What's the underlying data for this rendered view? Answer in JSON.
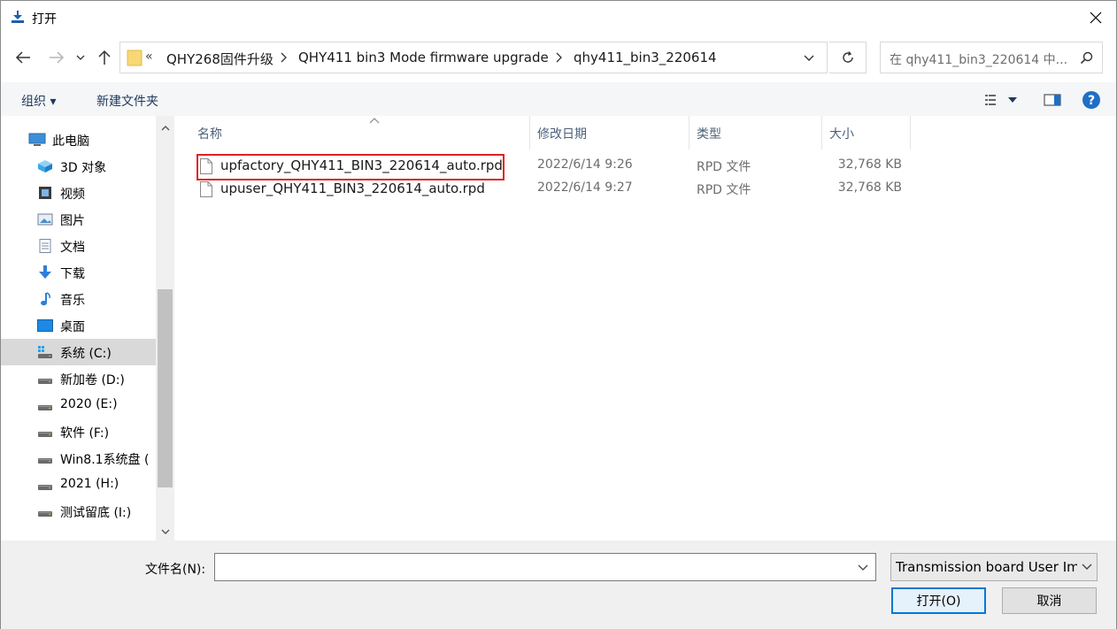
{
  "window": {
    "title": "打开"
  },
  "address": {
    "overflow": "«",
    "crumbs": [
      "QHY268固件升级",
      "QHY411 bin3 Mode firmware upgrade",
      "qhy411_bin3_220614"
    ]
  },
  "search": {
    "placeholder": "在 qhy411_bin3_220614 中..."
  },
  "toolbar": {
    "organize": "组织 ▾",
    "new_folder": "新建文件夹"
  },
  "nav": {
    "items": [
      {
        "label": "此电脑",
        "icon": "computer-icon"
      },
      {
        "label": "3D 对象",
        "icon": "cube-icon"
      },
      {
        "label": "视频",
        "icon": "video-icon"
      },
      {
        "label": "图片",
        "icon": "picture-icon"
      },
      {
        "label": "文档",
        "icon": "document-icon"
      },
      {
        "label": "下载",
        "icon": "download-icon"
      },
      {
        "label": "音乐",
        "icon": "music-icon"
      },
      {
        "label": "桌面",
        "icon": "desktop-icon"
      },
      {
        "label": "系统 (C:)",
        "icon": "system-drive-icon"
      },
      {
        "label": "新加卷 (D:)",
        "icon": "drive-icon"
      },
      {
        "label": "2020 (E:)",
        "icon": "drive-icon"
      },
      {
        "label": "软件 (F:)",
        "icon": "drive-icon"
      },
      {
        "label": "Win8.1系统盘 (",
        "icon": "drive-icon"
      },
      {
        "label": "2021 (H:)",
        "icon": "drive-icon"
      },
      {
        "label": "测试留底 (I:)",
        "icon": "drive-icon"
      }
    ]
  },
  "columns": {
    "name": "名称",
    "date": "修改日期",
    "type": "类型",
    "size": "大小"
  },
  "files": [
    {
      "name": "upfactory_QHY411_BIN3_220614_auto.rpd",
      "date": "2022/6/14 9:26",
      "type": "RPD 文件",
      "size": "32,768 KB"
    },
    {
      "name": "upuser_QHY411_BIN3_220614_auto.rpd",
      "date": "2022/6/14 9:27",
      "type": "RPD 文件",
      "size": "32,768 KB"
    }
  ],
  "bottom": {
    "filename_label": "文件名(N):",
    "filename_value": "",
    "filetype": "Transmission board User Im",
    "open": "打开(O)",
    "cancel": "取消"
  },
  "colors": {
    "accent": "#0078d7",
    "highlight": "#e02020",
    "selected_nav": "#d9d9d9",
    "help": "#1f6fc5"
  }
}
